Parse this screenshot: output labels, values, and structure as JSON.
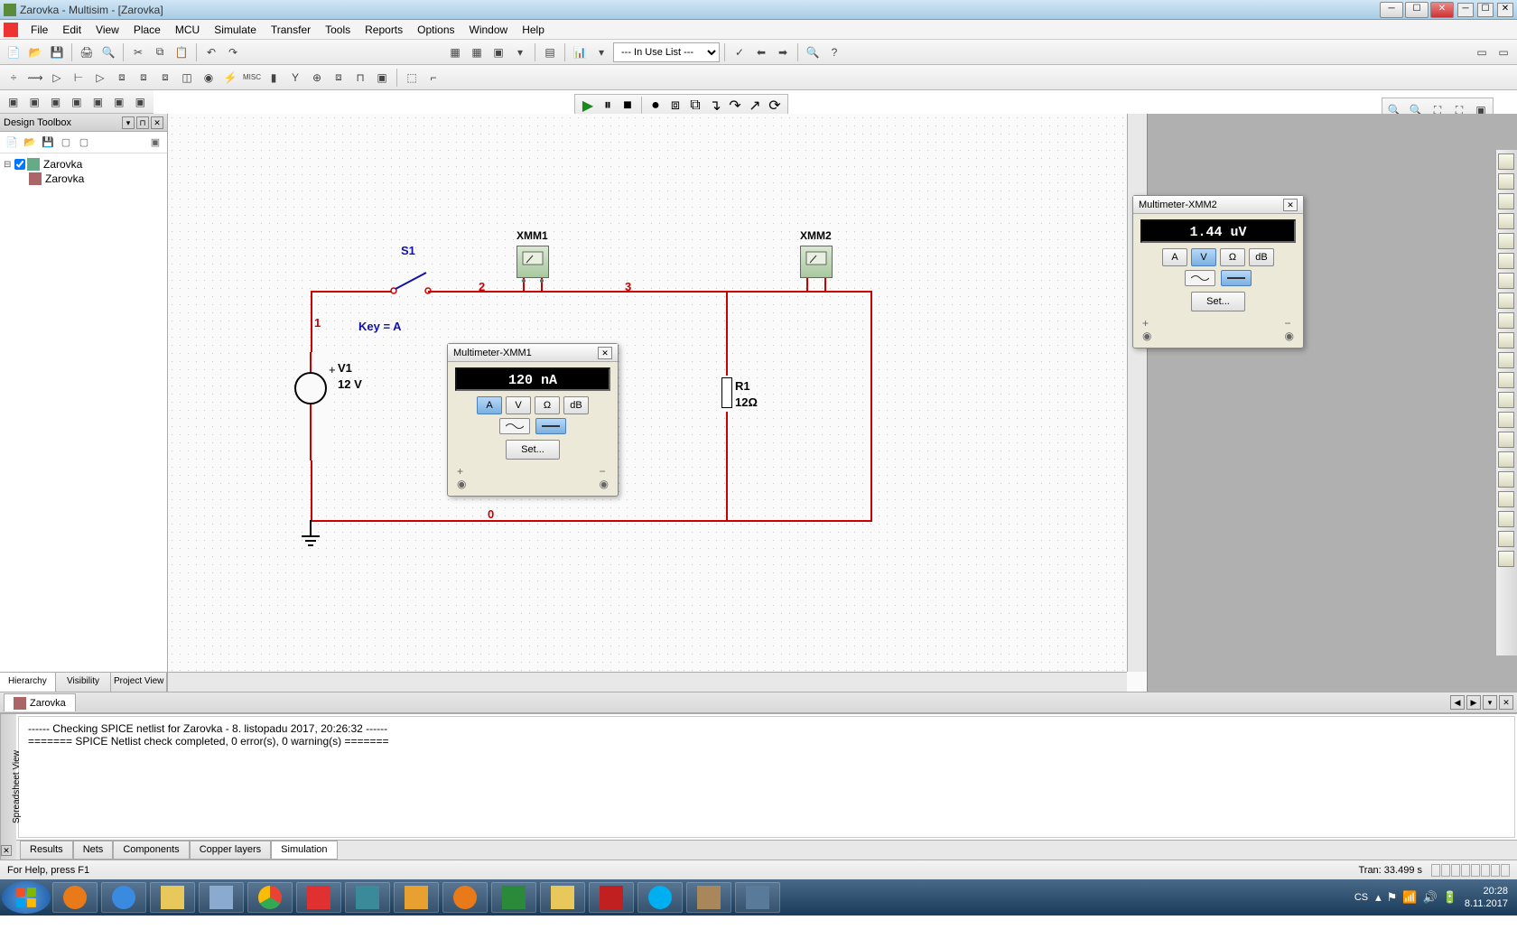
{
  "window": {
    "title": "Zarovka - Multisim - [Zarovka]"
  },
  "menu": [
    "File",
    "Edit",
    "View",
    "Place",
    "MCU",
    "Simulate",
    "Transfer",
    "Tools",
    "Reports",
    "Options",
    "Window",
    "Help"
  ],
  "toolbar_combo": "--- In Use List ---",
  "design_toolbox": {
    "title": "Design Toolbox",
    "root": "Zarovka",
    "child": "Zarovka",
    "tabs": [
      "Hierarchy",
      "Visibility",
      "Project View"
    ]
  },
  "schematic": {
    "s1": "S1",
    "key": "Key = A",
    "v1_name": "V1",
    "v1_val": "12 V",
    "r1_name": "R1",
    "r1_val": "12Ω",
    "xmm1": "XMM1",
    "xmm2": "XMM2",
    "net1": "1",
    "net2": "2",
    "net3": "3",
    "net0": "0"
  },
  "mm1": {
    "title": "Multimeter-XMM1",
    "reading": "120 nA",
    "btn_a": "A",
    "btn_v": "V",
    "btn_ohm": "Ω",
    "btn_db": "dB",
    "set": "Set..."
  },
  "mm2": {
    "title": "Multimeter-XMM2",
    "reading": "1.44 uV",
    "btn_a": "A",
    "btn_v": "V",
    "btn_ohm": "Ω",
    "btn_db": "dB",
    "set": "Set..."
  },
  "doc_tab": "Zarovka",
  "output": {
    "line1": "------ Checking SPICE netlist for Zarovka  - 8. listopadu 2017, 20:26:32 ------",
    "line2": "======= SPICE Netlist check completed, 0 error(s), 0 warning(s) =======",
    "tabs": [
      "Results",
      "Nets",
      "Components",
      "Copper layers",
      "Simulation"
    ],
    "side_label": "Spreadsheet View"
  },
  "status": {
    "left": "For Help, press F1",
    "right": "Tran: 33.499 s"
  },
  "tray": {
    "lang": "CS",
    "time": "20:28",
    "date": "8.11.2017"
  }
}
